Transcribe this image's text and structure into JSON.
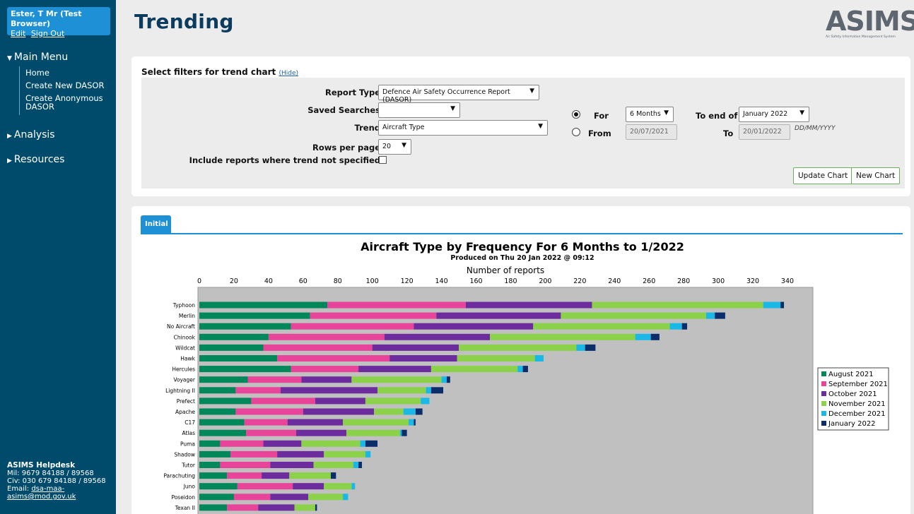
{
  "user": {
    "name": "Ester, T Mr (Test Browser)",
    "edit": "Edit",
    "sign_out": "Sign Out"
  },
  "menu": {
    "main": "Main Menu",
    "items": [
      "Home",
      "Create New DASOR",
      "Create Anonymous DASOR"
    ],
    "analysis": "Analysis",
    "resources": "Resources"
  },
  "helpdesk": {
    "title": "ASIMS Helpdesk",
    "mil": "Mil: 9679 84188 / 89568",
    "civ": "Civ: 030 679 84188 / 89568",
    "email_label": "Email:",
    "email": "dsa-maa-asims@mod.gov.uk"
  },
  "page": {
    "title": "Trending"
  },
  "logo": {
    "text": "ASIMS",
    "sub": "Air Safety Information Management System"
  },
  "filters": {
    "title": "Select filters for trend chart",
    "hide": "(Hide)",
    "report_type_label": "Report Type",
    "report_type_value": "Defence Air Safety Occurrence Report (DASOR)",
    "saved_searches_label": "Saved Searches",
    "saved_searches_value": "",
    "trend_label": "Trend",
    "trend_value": "Aircraft Type",
    "rows_label": "Rows per page",
    "rows_value": "20",
    "include_label": "Include reports where trend not specified",
    "for_label": "For",
    "for_value": "6 Months",
    "to_end_label": "To end of",
    "to_end_value": "January 2022",
    "from_label": "From",
    "from_value": "20/07/2021",
    "to_label": "To",
    "to_value": "20/01/2022",
    "date_format": "DD/MM/YYYY",
    "update_button": "Update Chart",
    "new_button": "New Chart"
  },
  "tabs": {
    "initial": "Initial"
  },
  "colors": {
    "sidebar": "#004b6b",
    "accent": "#1e90d6",
    "title": "#0b3c5d",
    "button_border": "#6cae5c"
  },
  "chart_data": {
    "type": "bar",
    "orientation": "horizontal",
    "stacked": true,
    "title": "Aircraft Type by Frequency For 6 Months to 1/2022",
    "subtitle": "Produced on Thu 20 Jan 2022 @ 09:12",
    "xlabel": "Number of reports",
    "xticks": [
      0,
      20,
      40,
      60,
      80,
      100,
      120,
      140,
      160,
      180,
      200,
      220,
      240,
      260,
      280,
      300,
      320,
      340
    ],
    "xlim": [
      0,
      355
    ],
    "legend_position": "right",
    "categories": [
      "Typhoon",
      "Merlin",
      "No Aircraft",
      "Chinook",
      "Wildcat",
      "Hawk",
      "Hercules",
      "Voyager",
      "Lightning II",
      "Prefect",
      "Apache",
      "C17",
      "Atlas",
      "Puma",
      "Shadow",
      "Tutor",
      "Parachuting",
      "Juno",
      "Poseidon",
      "Texan II"
    ],
    "series": [
      {
        "name": "August 2021",
        "color": "#00875a",
        "values": [
          74,
          64,
          53,
          40,
          37,
          45,
          53,
          28,
          21,
          30,
          21,
          26,
          27,
          12,
          18,
          12,
          16,
          22,
          20,
          16
        ]
      },
      {
        "name": "September 2021",
        "color": "#e8449a",
        "values": [
          80,
          73,
          71,
          67,
          63,
          65,
          39,
          31,
          26,
          37,
          39,
          25,
          29,
          25,
          27,
          29,
          20,
          32,
          21,
          18
        ]
      },
      {
        "name": "October 2021",
        "color": "#6d2c9e",
        "values": [
          73,
          72,
          69,
          61,
          50,
          39,
          42,
          29,
          56,
          29,
          41,
          32,
          29,
          22,
          27,
          25,
          16,
          18,
          22,
          21
        ]
      },
      {
        "name": "November 2021",
        "color": "#8bd24a",
        "values": [
          99,
          84,
          79,
          84,
          68,
          45,
          50,
          52,
          28,
          32,
          17,
          38,
          31,
          34,
          24,
          23,
          24,
          16,
          20,
          12
        ]
      },
      {
        "name": "December 2021",
        "color": "#1ab8e6",
        "values": [
          10,
          5,
          7,
          9,
          5,
          5,
          3,
          3,
          3,
          5,
          7,
          3,
          1,
          3,
          3,
          3,
          0,
          2,
          3,
          0
        ]
      },
      {
        "name": "January 2022",
        "color": "#0b2e6b",
        "values": [
          2,
          6,
          3,
          5,
          6,
          0,
          3,
          2,
          7,
          0,
          4,
          1,
          3,
          7,
          0,
          2,
          3,
          0,
          0,
          1
        ]
      }
    ]
  }
}
